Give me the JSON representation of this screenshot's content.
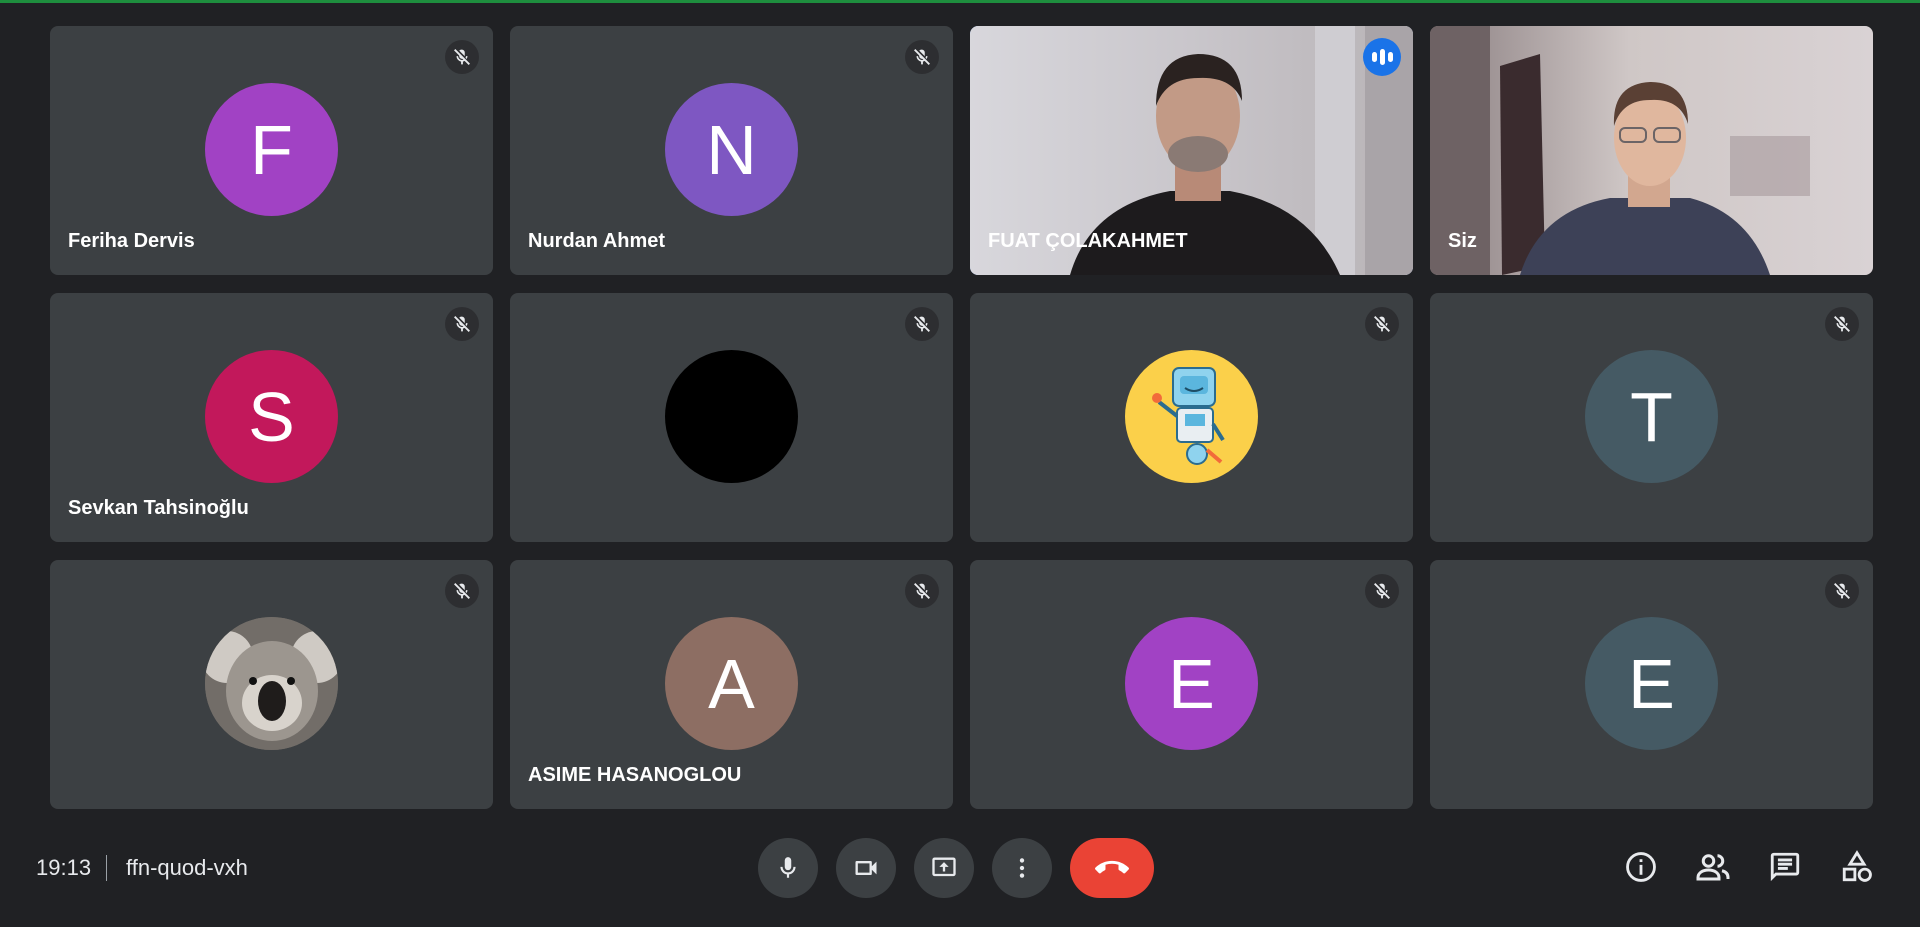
{
  "meeting": {
    "time": "19:13",
    "code": "ffn-quod-vxh"
  },
  "colors": {
    "background": "#202124",
    "tile": "#3c4043",
    "speaking_outline": "#669df6",
    "hangup": "#ea4335",
    "accent": "#1a73e8"
  },
  "participants": [
    {
      "name": "Feriha Dervis",
      "initial": "F",
      "avatar_color": "#a142c4",
      "muted": true
    },
    {
      "name": "Nurdan Ahmet",
      "initial": "N",
      "avatar_color": "#7e57c2",
      "muted": true
    },
    {
      "name": "FUAT ÇOLAKAHMET",
      "video": true,
      "speaking": true
    },
    {
      "name": "Siz",
      "video": true
    },
    {
      "name": "Sevkan Tahsinoğlu",
      "initial": "S",
      "avatar_color": "#c2185b",
      "muted": true
    },
    {
      "name": "",
      "initial": "",
      "avatar_color": "#000000",
      "muted": true
    },
    {
      "name": "",
      "avatar_image": "robot-illustration",
      "avatar_color": "#fbd04a",
      "muted": true
    },
    {
      "name": "",
      "initial": "T",
      "avatar_color": "#455a64",
      "muted": true
    },
    {
      "name": "",
      "avatar_image": "koala-photo",
      "muted": true
    },
    {
      "name": "ASIME HASANOGLOU",
      "initial": "A",
      "avatar_color": "#8d6e63",
      "muted": true
    },
    {
      "name": "",
      "initial": "E",
      "avatar_color": "#a142c4",
      "muted": true
    },
    {
      "name": "",
      "initial": "E",
      "avatar_color": "#455a64",
      "muted": true
    }
  ],
  "icons": {
    "muted": "mic-off-icon",
    "speaking": "audio-level-icon",
    "controls": [
      "mic-icon",
      "camera-icon",
      "present-screen-icon",
      "more-options-icon",
      "hang-up-icon"
    ],
    "side": [
      "info-icon",
      "people-icon",
      "chat-icon",
      "activities-icon"
    ]
  }
}
